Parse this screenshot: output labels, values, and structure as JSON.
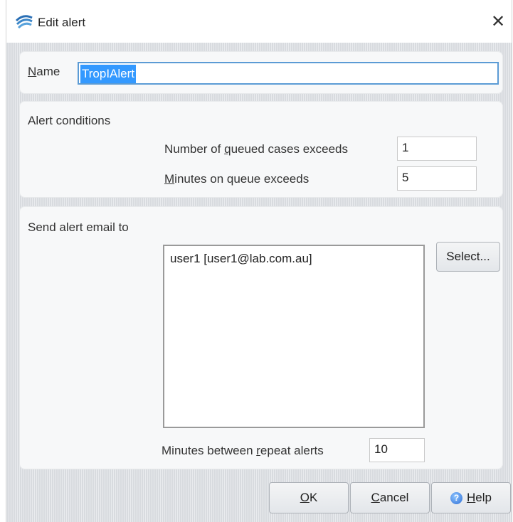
{
  "window": {
    "title": "Edit alert",
    "close_symbol": "✕"
  },
  "name_section": {
    "label": "Name",
    "label_underline_letter": "N",
    "value": "TropIAlert"
  },
  "conditions_section": {
    "heading": "Alert conditions",
    "queued_cases_label_pre": "Number of ",
    "queued_cases_label_u": "q",
    "queued_cases_label_post": "ueued cases exceeds",
    "queued_cases_value": "1",
    "minutes_on_queue_label_u": "M",
    "minutes_on_queue_label_post": "inutes on queue exceeds",
    "minutes_on_queue_value": "5"
  },
  "email_section": {
    "heading": "Send alert email to",
    "recipients": [
      "user1 [user1@lab.com.au]"
    ],
    "select_button": "Select...",
    "repeat_label_pre": "Minutes between ",
    "repeat_label_u": "r",
    "repeat_label_post": "epeat alerts",
    "repeat_value": "10"
  },
  "footer": {
    "ok_u": "O",
    "ok_rest": "K",
    "cancel_u": "C",
    "cancel_rest": "ancel",
    "help_u": "H",
    "help_rest": "elp",
    "help_icon_glyph": "?"
  }
}
